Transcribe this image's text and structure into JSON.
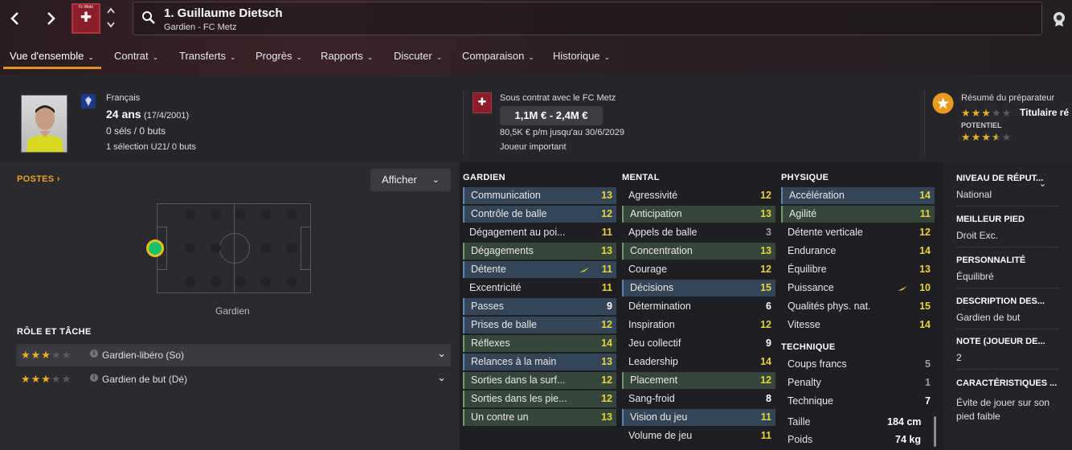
{
  "nav": {
    "back": "‹",
    "forward": "›",
    "club_small": "Fc Metz"
  },
  "player": {
    "title": "1. Guillaume Dietsch",
    "subtitle": "Gardien - FC Metz"
  },
  "menu": [
    {
      "label": "Vue d'ensemble"
    },
    {
      "label": "Contrat"
    },
    {
      "label": "Transferts"
    },
    {
      "label": "Progrès"
    },
    {
      "label": "Rapports"
    },
    {
      "label": "Discuter"
    },
    {
      "label": "Comparaison"
    },
    {
      "label": "Historique"
    }
  ],
  "info": {
    "nationality": "Français",
    "age": "24 ans",
    "dob": "(17/4/2001)",
    "caps": "0 séls / 0 buts",
    "u21": "1 sélection U21/ 0 buts",
    "contract_title": "Sous contrat avec le FC Metz",
    "value_range": "1,1M € - 2,4M €",
    "wage": "80,5K € p/m jusqu'au 30/6/2029",
    "status": "Joueur important",
    "coach_title": "Résumé du préparateur",
    "coach_verdict": "Titulaire ré",
    "potential_label": "POTENTIEL",
    "current_stars": 3,
    "potential_stars": 3.5
  },
  "left": {
    "positions_label": "POSTES",
    "show_button": "Afficher",
    "position_name": "Gardien",
    "roles_label": "RÔLE ET TÂCHE",
    "roles": [
      {
        "name": "Gardien-libéro (So)",
        "stars": 3
      },
      {
        "name": "Gardien de but (Dé)",
        "stars": 3
      }
    ]
  },
  "attributes": {
    "gk_title": "GARDIEN",
    "mental_title": "MENTAL",
    "physical_title": "PHYSIQUE",
    "tech_title": "TECHNIQUE",
    "gk": [
      {
        "name": "Communication",
        "value": "13",
        "hl": "blue"
      },
      {
        "name": "Contrôle de balle",
        "value": "12",
        "hl": "blue"
      },
      {
        "name": "Dégagement au poi...",
        "value": "11",
        "hl": ""
      },
      {
        "name": "Dégagements",
        "value": "13",
        "hl": "green"
      },
      {
        "name": "Détente",
        "value": "11",
        "hl": "blue",
        "arrow": true
      },
      {
        "name": "Excentricité",
        "value": "11",
        "hl": ""
      },
      {
        "name": "Passes",
        "value": "9",
        "hl": "blue"
      },
      {
        "name": "Prises de balle",
        "value": "12",
        "hl": "blue"
      },
      {
        "name": "Réflexes",
        "value": "14",
        "hl": "green"
      },
      {
        "name": "Relances à la main",
        "value": "13",
        "hl": "blue"
      },
      {
        "name": "Sorties dans la surf...",
        "value": "12",
        "hl": "green"
      },
      {
        "name": "Sorties dans les pie...",
        "value": "12",
        "hl": "green"
      },
      {
        "name": "Un contre un",
        "value": "13",
        "hl": "green"
      }
    ],
    "mental": [
      {
        "name": "Agressivité",
        "value": "12",
        "hl": ""
      },
      {
        "name": "Anticipation",
        "value": "13",
        "hl": "green"
      },
      {
        "name": "Appels de balle",
        "value": "3",
        "hl": ""
      },
      {
        "name": "Concentration",
        "value": "13",
        "hl": "green"
      },
      {
        "name": "Courage",
        "value": "12",
        "hl": ""
      },
      {
        "name": "Décisions",
        "value": "15",
        "hl": "blue"
      },
      {
        "name": "Détermination",
        "value": "6",
        "hl": ""
      },
      {
        "name": "Inspiration",
        "value": "12",
        "hl": ""
      },
      {
        "name": "Jeu collectif",
        "value": "9",
        "hl": ""
      },
      {
        "name": "Leadership",
        "value": "14",
        "hl": ""
      },
      {
        "name": "Placement",
        "value": "12",
        "hl": "green"
      },
      {
        "name": "Sang-froid",
        "value": "8",
        "hl": ""
      },
      {
        "name": "Vision du jeu",
        "value": "11",
        "hl": "blue"
      },
      {
        "name": "Volume de jeu",
        "value": "11",
        "hl": ""
      }
    ],
    "physical": [
      {
        "name": "Accélération",
        "value": "14",
        "hl": "blue"
      },
      {
        "name": "Agilité",
        "value": "11",
        "hl": "green"
      },
      {
        "name": "Détente verticale",
        "value": "12",
        "hl": ""
      },
      {
        "name": "Endurance",
        "value": "14",
        "hl": ""
      },
      {
        "name": "Équilibre",
        "value": "13",
        "hl": ""
      },
      {
        "name": "Puissance",
        "value": "10",
        "hl": "",
        "arrow": true
      },
      {
        "name": "Qualités phys. nat.",
        "value": "15",
        "hl": ""
      },
      {
        "name": "Vitesse",
        "value": "14",
        "hl": ""
      }
    ],
    "technical": [
      {
        "name": "Coups francs",
        "value": "5",
        "hl": ""
      },
      {
        "name": "Penalty",
        "value": "1",
        "hl": ""
      },
      {
        "name": "Technique",
        "value": "7",
        "hl": ""
      }
    ],
    "height_label": "Taille",
    "height": "184 cm",
    "weight_label": "Poids",
    "weight": "74 kg"
  },
  "right": [
    {
      "label": "NIVEAU DE RÉPUT...",
      "value": "National"
    },
    {
      "label": "MEILLEUR PIED",
      "value": "Droit Exc."
    },
    {
      "label": "PERSONNALITÉ",
      "value": "Équilibré"
    },
    {
      "label": "DESCRIPTION DES...",
      "value": "Gardien de but"
    },
    {
      "label": "NOTE (JOUEUR DE...",
      "value": "2"
    },
    {
      "label": "CARACTÉRISTIQUES ...",
      "value": "Évite de jouer sur son pied faible"
    }
  ]
}
